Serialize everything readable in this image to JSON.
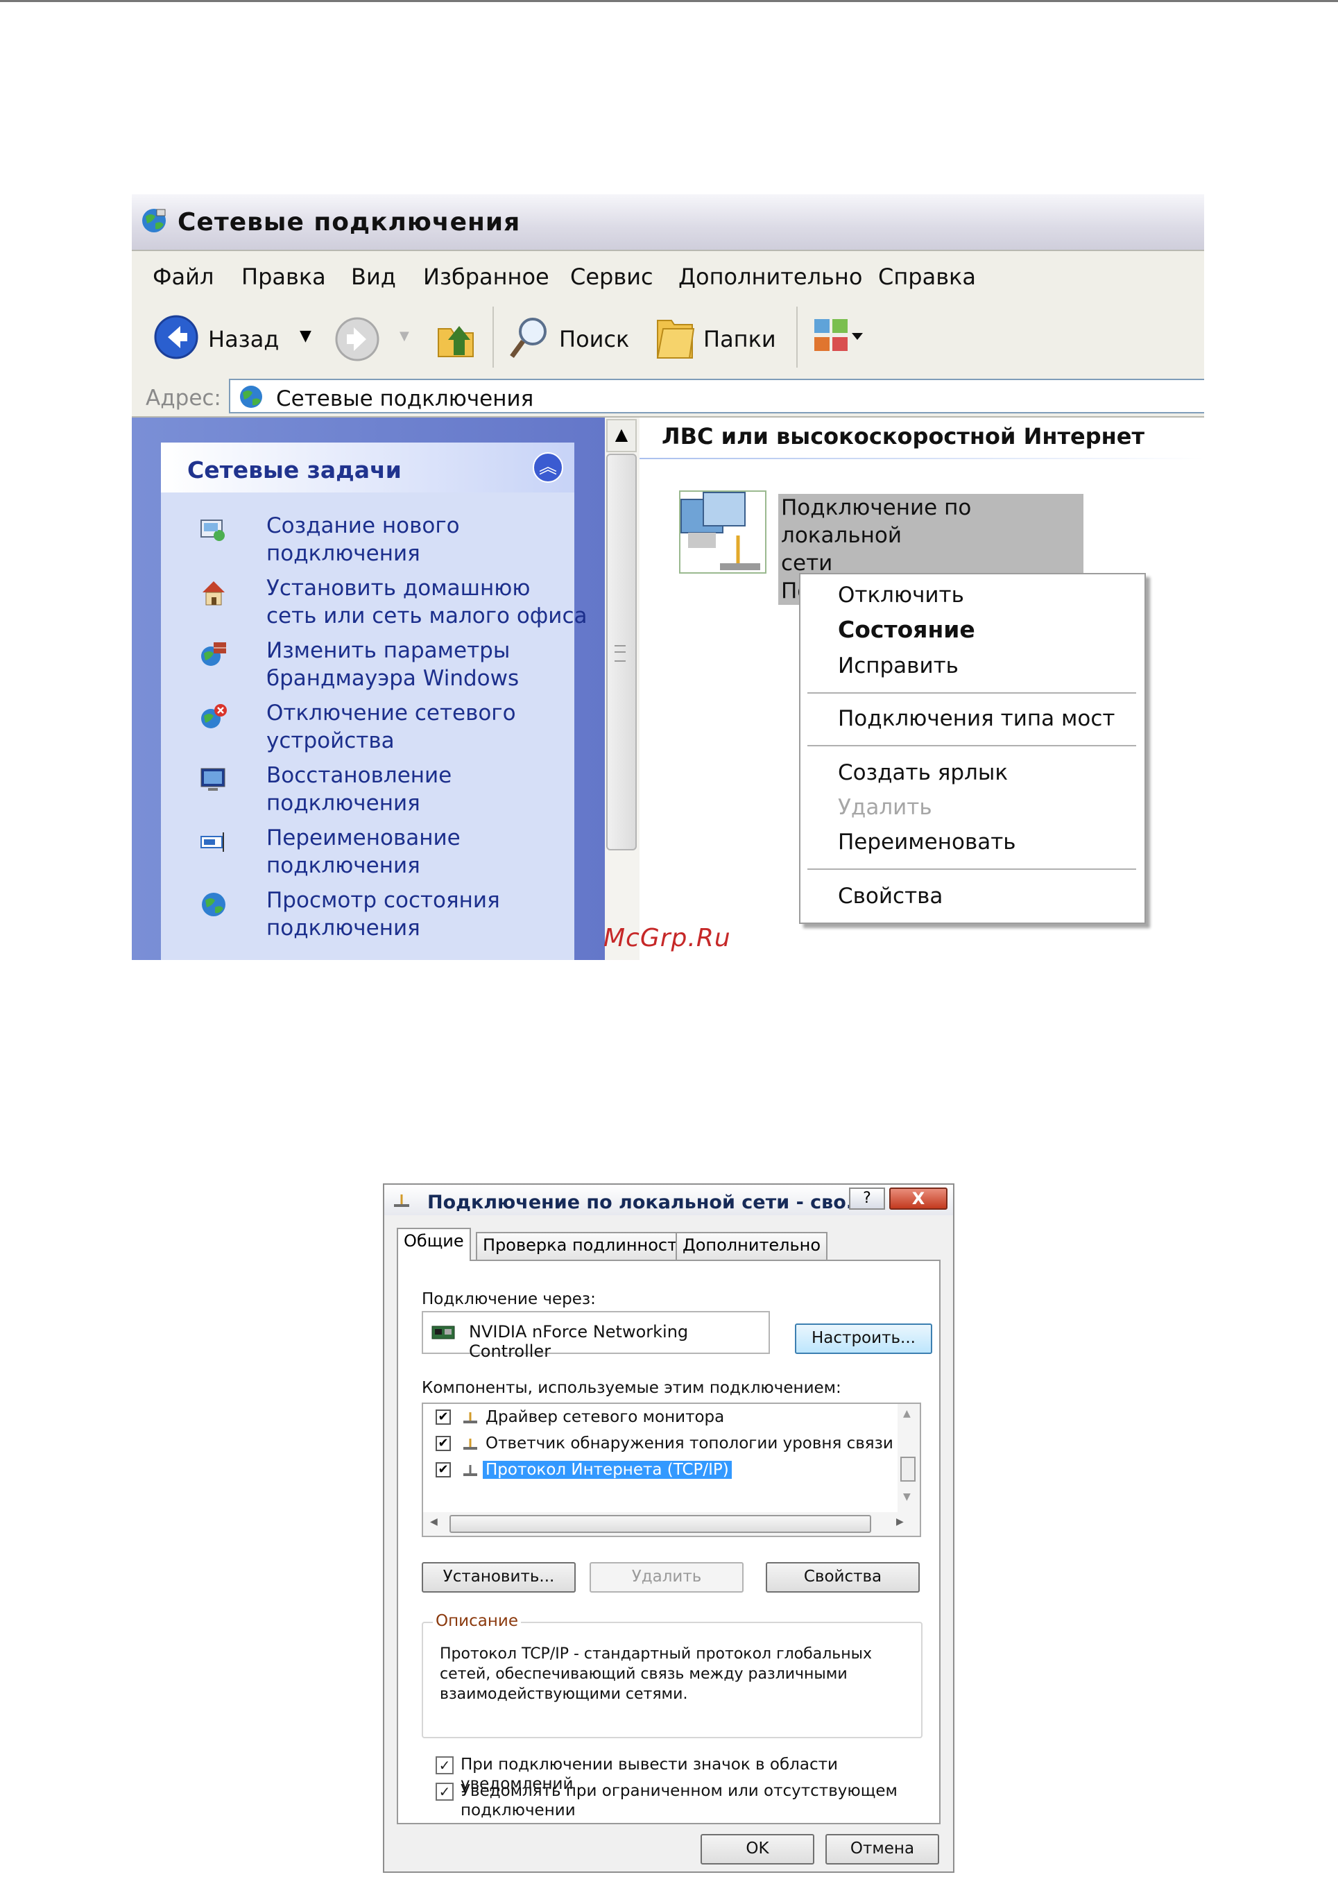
{
  "window1": {
    "title": "Сетевые подключения",
    "menu": [
      "Файл",
      "Правка",
      "Вид",
      "Избранное",
      "Сервис",
      "Дополнительно",
      "Справка"
    ],
    "toolbar": {
      "back_label": "Назад",
      "search_label": "Поиск",
      "folders_label": "Папки"
    },
    "address": {
      "caption": "Адрес:",
      "value": "Сетевые подключения"
    },
    "tasks": {
      "title": "Сетевые задачи",
      "items": [
        {
          "l1": "Создание нового",
          "l2": "подключения",
          "icon": "new-connection-icon"
        },
        {
          "l1": "Установить домашнюю",
          "l2": "сеть или сеть малого офиса",
          "icon": "home-network-icon"
        },
        {
          "l1": "Изменить параметры",
          "l2": "брандмауэра Windows",
          "icon": "firewall-icon"
        },
        {
          "l1": "Отключение сетевого",
          "l2": "устройства",
          "icon": "disable-device-icon"
        },
        {
          "l1": "Восстановление",
          "l2": "подключения",
          "icon": "repair-icon"
        },
        {
          "l1": "Переименование",
          "l2": "подключения",
          "icon": "rename-icon"
        },
        {
          "l1": "Просмотр состояния",
          "l2": "подключения",
          "icon": "status-icon"
        }
      ]
    },
    "group_header": "ЛВС или высокоскоростной Интернет",
    "connection": {
      "line1": "Подключение по локальной",
      "line2": "сети",
      "line3": "По"
    },
    "context_menu": {
      "disconnect": "Отключить",
      "status": "Состояние",
      "repair": "Исправить",
      "bridge": "Подключения типа мост",
      "shortcut": "Создать ярлык",
      "delete": "Удалить",
      "rename": "Переименовать",
      "properties": "Свойства"
    },
    "watermark": "McGrp.Ru"
  },
  "dialog": {
    "title": "Подключение по локальной сети - сво...",
    "help_glyph": "?",
    "close_glyph": "X",
    "tabs": [
      "Общие",
      "Проверка подлинности",
      "Дополнительно"
    ],
    "connect_via_label": "Подключение через:",
    "adapter": "NVIDIA nForce Networking Controller",
    "configure_button": "Настроить...",
    "components_label": "Компоненты, используемые этим подключением:",
    "components": [
      {
        "name": "Драйвер сетевого монитора",
        "checked": true,
        "selected": false
      },
      {
        "name": "Ответчик обнаружения топологии уровня связи",
        "checked": true,
        "selected": false
      },
      {
        "name": "Протокол Интернета (TCP/IP)",
        "checked": true,
        "selected": true
      }
    ],
    "install_button": "Установить...",
    "uninstall_button": "Удалить",
    "properties_button": "Свойства",
    "description_caption": "Описание",
    "description_text": "Протокол TCP/IP - стандартный протокол глобальных сетей, обеспечивающий связь между различными взаимодействующими сетями.",
    "show_icon_label": "При подключении вывести значок в области уведомлений",
    "notify_label": "Уведомлять при ограниченном или отсутствующем подключении",
    "ok_button": "OK",
    "cancel_button": "Отмена"
  }
}
